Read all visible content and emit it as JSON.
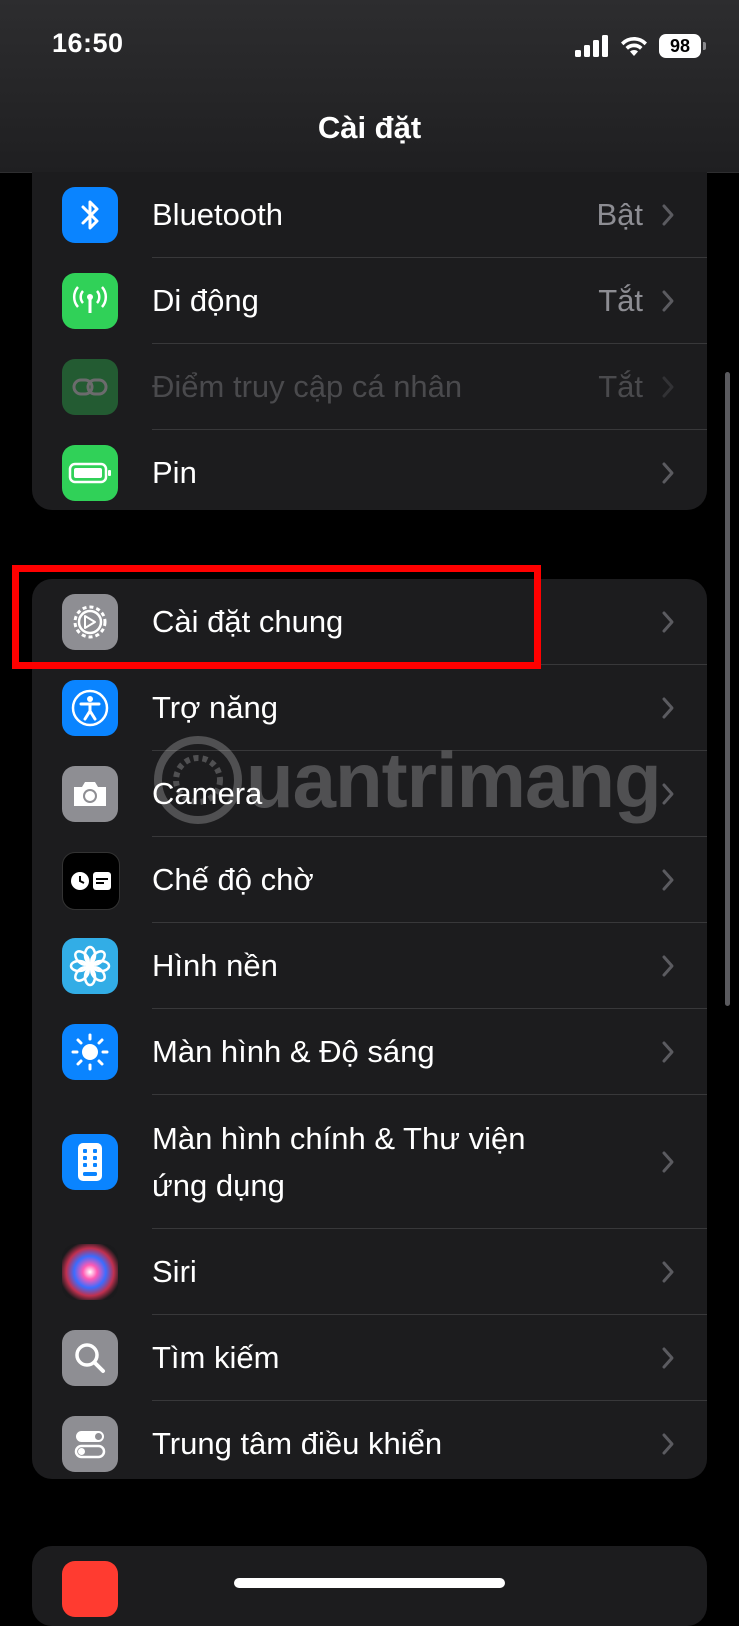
{
  "status_bar": {
    "time": "16:50",
    "battery_level": "98"
  },
  "nav": {
    "title": "Cài đặt"
  },
  "groups": [
    {
      "items": [
        {
          "label": "Bluetooth",
          "value": "Bật",
          "icon": "bluetooth-icon",
          "icon_color": "#0a84ff"
        },
        {
          "label": "Di động",
          "value": "Tắt",
          "icon": "cellular-antenna-icon",
          "icon_color": "#30d158"
        },
        {
          "label": "Điểm truy cập cá nhân",
          "value": "Tắt",
          "icon": "hotspot-link-icon",
          "icon_color": "#30d158",
          "disabled": true
        },
        {
          "label": "Pin",
          "value": "",
          "icon": "battery-icon",
          "icon_color": "#30d158"
        }
      ]
    },
    {
      "items": [
        {
          "label": "Cài đặt chung",
          "icon": "gear-icon",
          "icon_color": "#8e8e93",
          "highlighted": true
        },
        {
          "label": "Trợ năng",
          "icon": "accessibility-icon",
          "icon_color": "#0a84ff"
        },
        {
          "label": "Camera",
          "icon": "camera-icon",
          "icon_color": "#8e8e93"
        },
        {
          "label": "Chế độ chờ",
          "icon": "standby-icon",
          "icon_color": "#000000"
        },
        {
          "label": "Hình nền",
          "icon": "wallpaper-flower-icon",
          "icon_color": "#32ade6"
        },
        {
          "label": "Màn hình & Độ sáng",
          "icon": "brightness-sun-icon",
          "icon_color": "#0a84ff"
        },
        {
          "label": "Màn hình chính & Thư viện ứng dụng",
          "icon": "home-screen-icon",
          "icon_color": "#0a84ff"
        },
        {
          "label": "Siri",
          "icon": "siri-icon",
          "icon_color": "#1c1c1e"
        },
        {
          "label": "Tìm kiếm",
          "icon": "search-icon",
          "icon_color": "#8e8e93"
        },
        {
          "label": "Trung tâm điều khiển",
          "icon": "control-center-toggles-icon",
          "icon_color": "#8e8e93"
        }
      ]
    }
  ],
  "watermark": {
    "text": "uantrimang"
  },
  "colors": {
    "background": "#000000",
    "cell": "#1c1c1e",
    "separator": "#38383a",
    "secondary_text": "#8d8d93",
    "highlight_box": "#ff0000"
  }
}
